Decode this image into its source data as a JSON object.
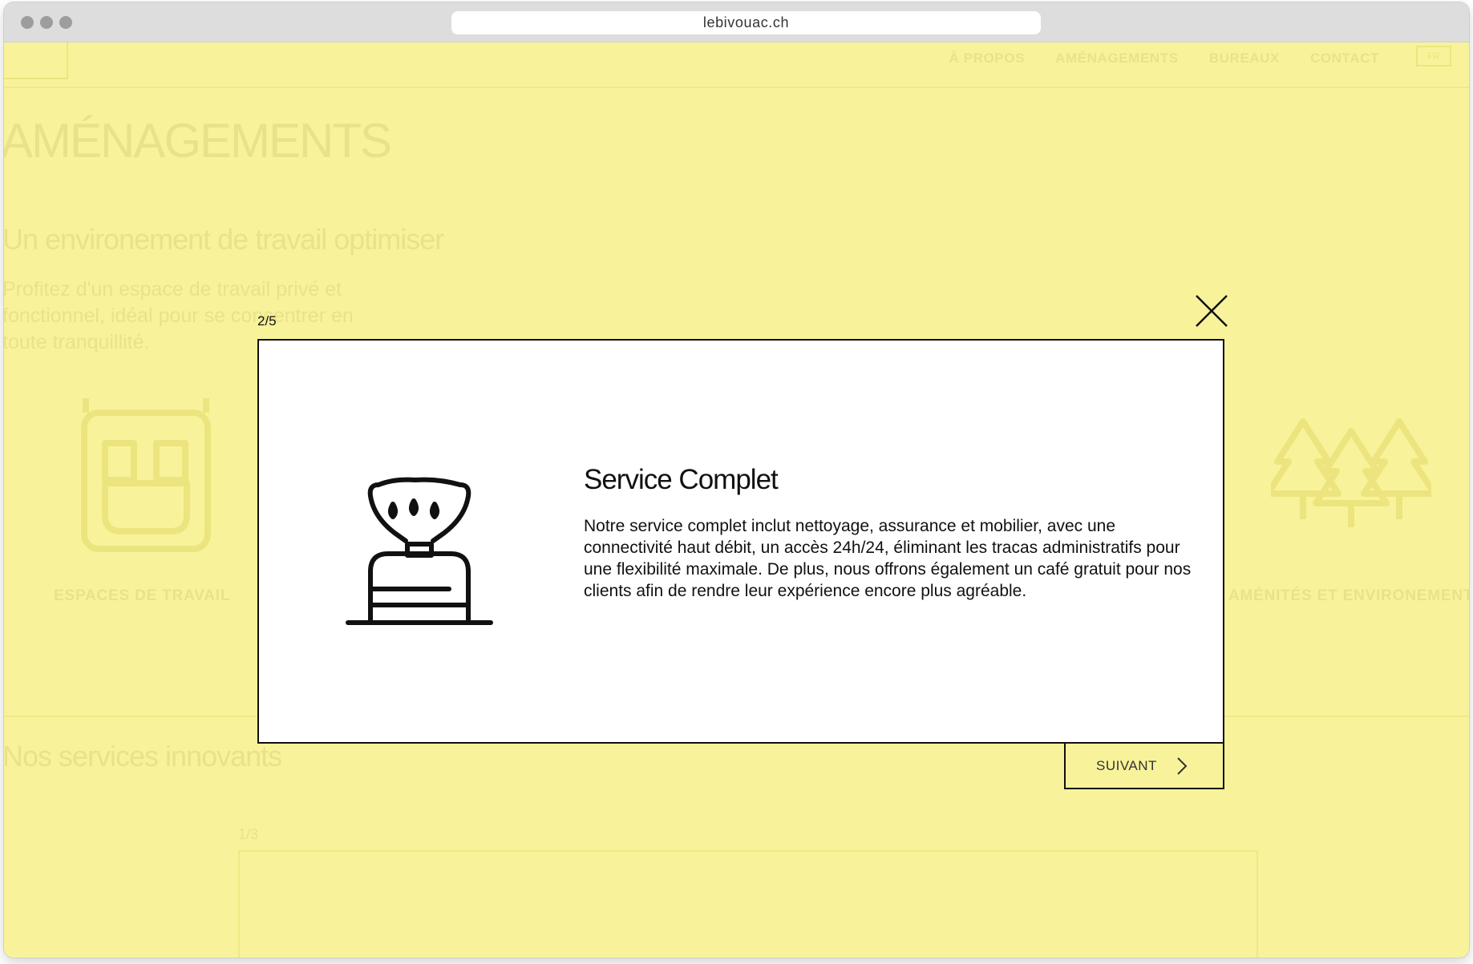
{
  "browser": {
    "url": "lebivouac.ch"
  },
  "nav": {
    "items": [
      "À PROPOS",
      "AMÉNAGEMENTS",
      "BUREAUX",
      "CONTACT"
    ],
    "lang": "FR"
  },
  "background": {
    "title": "AMÉNAGEMENTS",
    "subtitle": "Un environement de travail optimiser",
    "paragraph": "Profitez d'un espace de travail privé et fonctionnel, idéal pour se concentrer en toute tranquillité.",
    "label_left": "ESPACES DE TRAVAIL",
    "label_right": "AMÉNITÉS ET ENVIRONEMENT",
    "services_heading": "Nos services innovants",
    "services_counter": "1/3"
  },
  "modal": {
    "counter": "2/5",
    "title": "Service Complet",
    "text": "Notre service complet inclut nettoyage, assurance et mobilier, avec une connectivité haut débit, un accès 24h/24, éliminant les tracas administratifs pour une flexibilité maximale. De plus, nous offrons également un café gratuit pour nos clients afin de rendre leur expérience encore plus agréable.",
    "next_label": "SUIVANT",
    "icon": "camping-stove-icon",
    "close_icon": "close-icon"
  },
  "colors": {
    "overlay": "#f8f39a",
    "modal_bg": "#ffffff",
    "ink": "#111111"
  }
}
